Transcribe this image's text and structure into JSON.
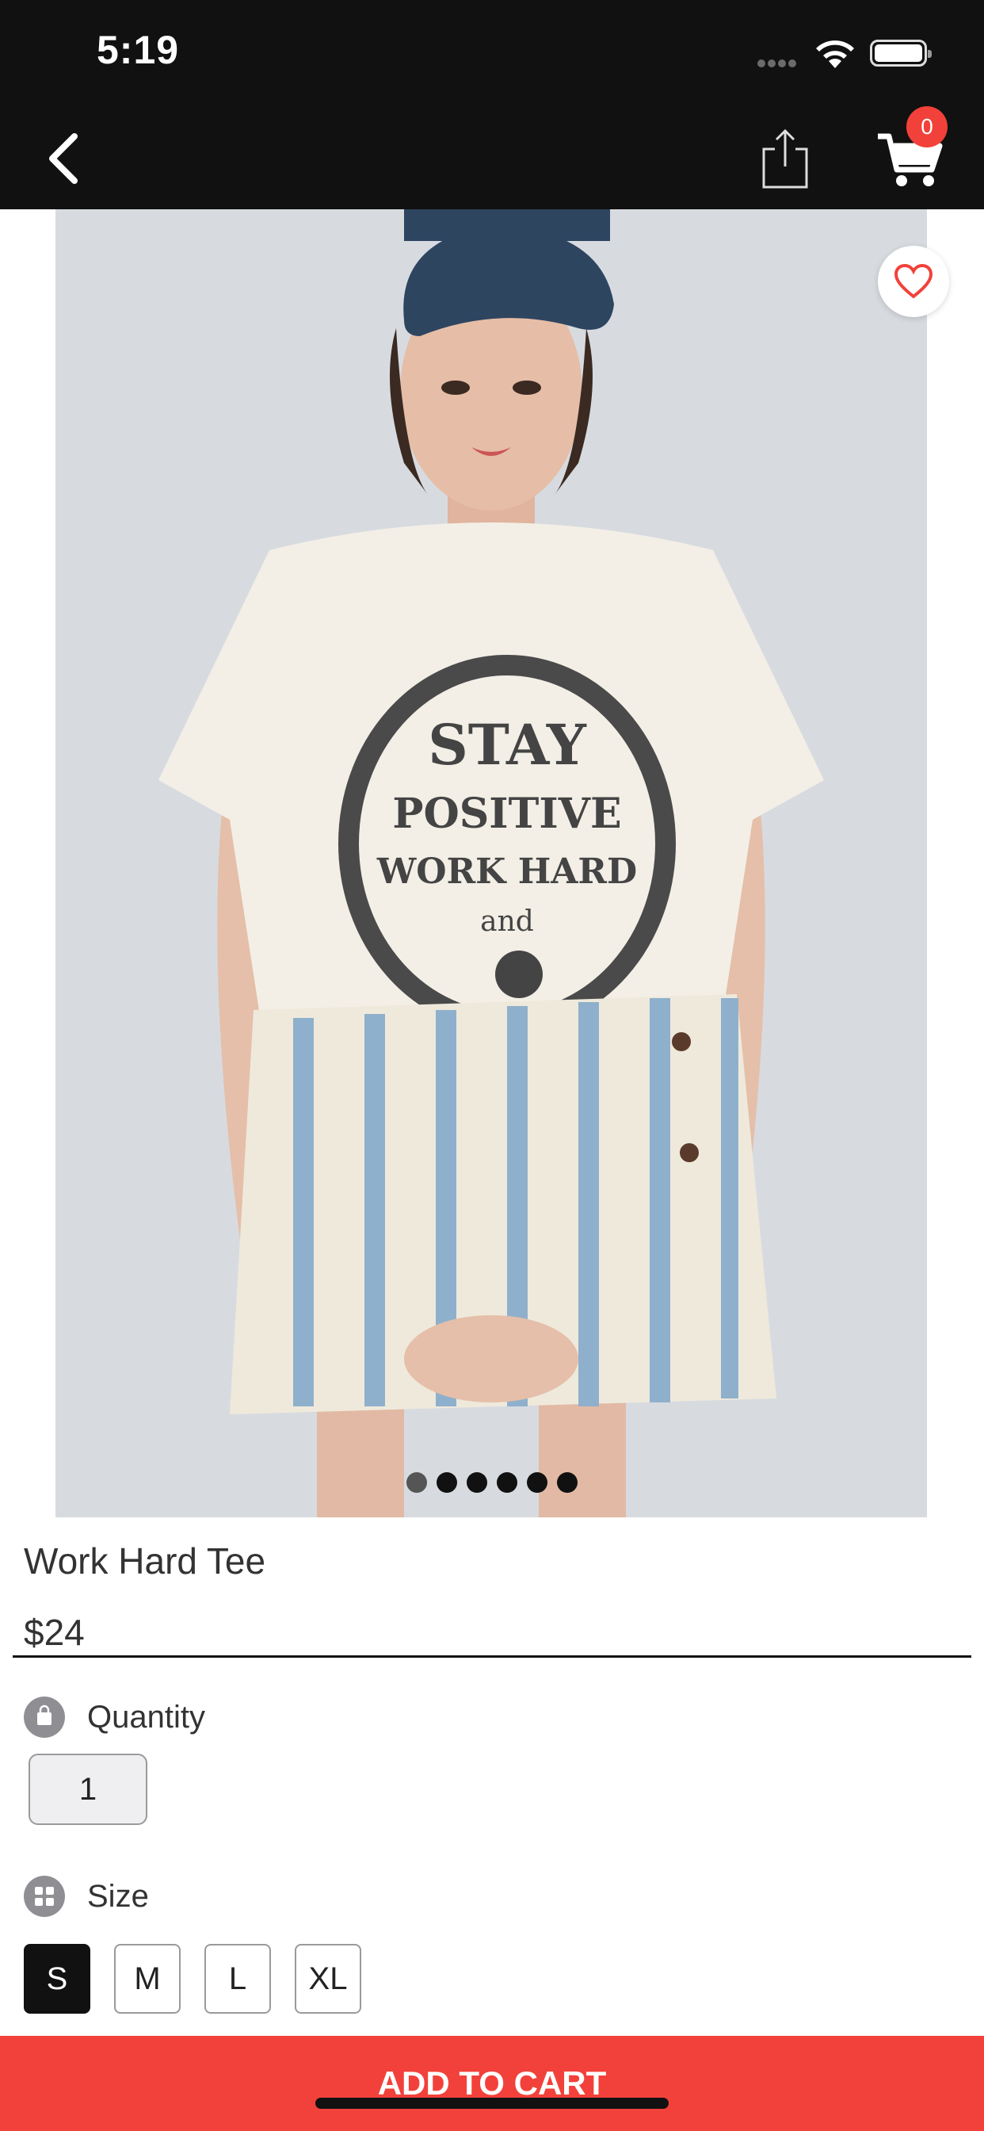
{
  "status_bar": {
    "time": "5:19"
  },
  "nav": {
    "cart_count": "0"
  },
  "product": {
    "title": "Work Hard Tee",
    "price": "$24",
    "image_count": 6,
    "active_image_index": 0
  },
  "quantity": {
    "label": "Quantity",
    "value": "1"
  },
  "size": {
    "label": "Size",
    "options": [
      "S",
      "M",
      "L",
      "XL"
    ],
    "selected": "S"
  },
  "add_to_cart": {
    "label": "ADD TO CART"
  },
  "colors": {
    "bar_background": "#111111",
    "accent_red": "#f2413a",
    "image_background": "#d7dbe0"
  }
}
